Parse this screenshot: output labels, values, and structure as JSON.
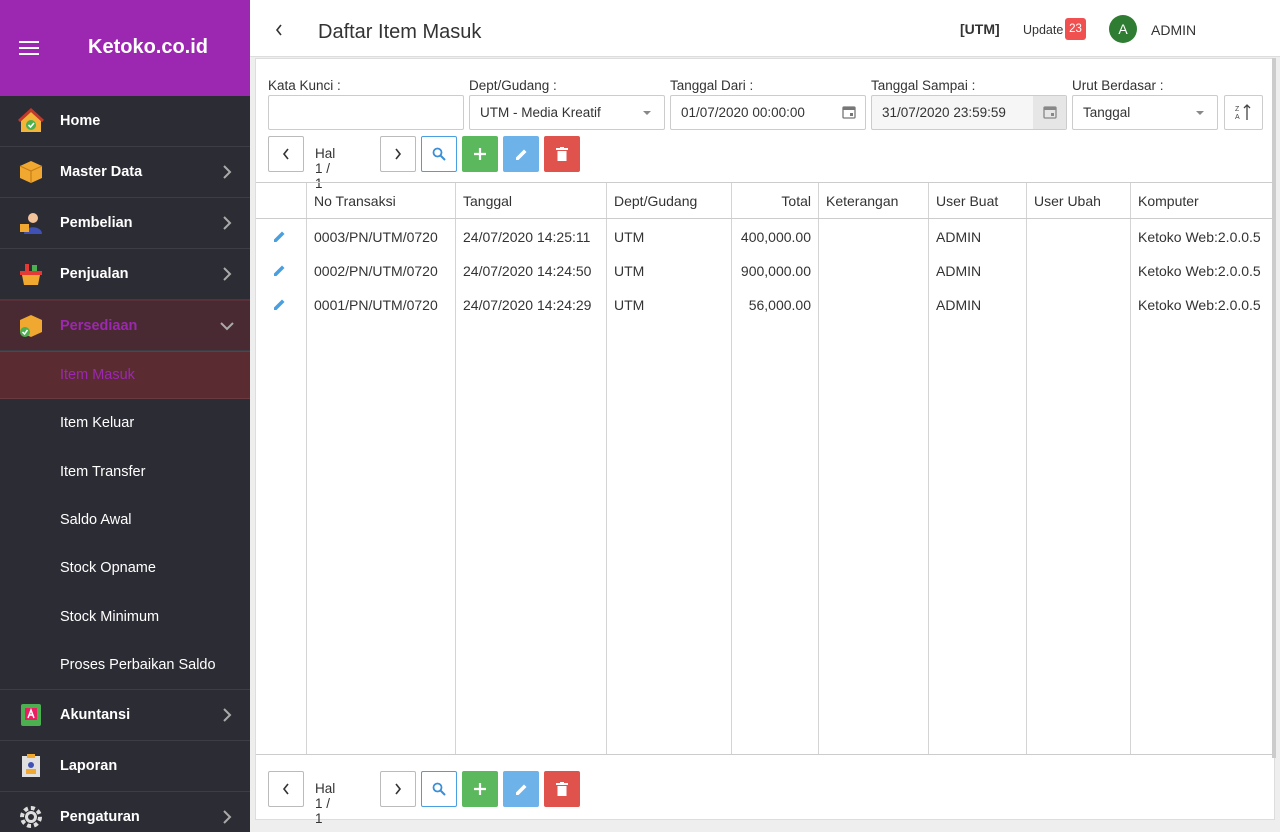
{
  "brand": {
    "name": "Ketoko.co.id",
    "color": "#9c27b0"
  },
  "sidebar": {
    "items": [
      {
        "label": "Home",
        "icon": "home-icon"
      },
      {
        "label": "Master Data",
        "icon": "box-icon"
      },
      {
        "label": "Pembelian",
        "icon": "buyer-icon"
      },
      {
        "label": "Penjualan",
        "icon": "basket-icon"
      },
      {
        "label": "Persediaan",
        "icon": "inventory-icon"
      },
      {
        "label": "Akuntansi",
        "icon": "ledger-icon"
      },
      {
        "label": "Laporan",
        "icon": "report-icon"
      },
      {
        "label": "Pengaturan",
        "icon": "gear-icon"
      }
    ],
    "sub_items": [
      "Item Masuk",
      "Item Keluar",
      "Item Transfer",
      "Saldo Awal",
      "Stock Opname",
      "Stock Minimum",
      "Proses Perbaikan Saldo"
    ]
  },
  "header": {
    "title": "Daftar Item Masuk",
    "branch": "[UTM]",
    "update_label": "Update",
    "update_count": "23",
    "avatar_letter": "A",
    "user": "ADMIN"
  },
  "filters": {
    "kata_kunci_label": "Kata Kunci :",
    "kata_kunci_value": "",
    "dept_label": "Dept/Gudang :",
    "dept_value": "UTM - Media Kreatif",
    "tanggal_dari_label": "Tanggal Dari :",
    "tanggal_dari_value": "01/07/2020 00:00:00",
    "tanggal_sampai_label": "Tanggal Sampai :",
    "tanggal_sampai_value": "31/07/2020 23:59:59",
    "urut_label": "Urut Berdasar :",
    "urut_value": "Tanggal"
  },
  "pagination": {
    "label": "Hal 1 / 1"
  },
  "table": {
    "columns": [
      "No Transaksi",
      "Tanggal",
      "Dept/Gudang",
      "Total",
      "Keterangan",
      "User Buat",
      "User Ubah",
      "Komputer"
    ],
    "rows": [
      [
        "0003/PN/UTM/0720",
        "24/07/2020 14:25:11",
        "UTM",
        "400,000.00",
        "",
        "ADMIN",
        "",
        "Ketoko Web:2.0.0.5"
      ],
      [
        "0002/PN/UTM/0720",
        "24/07/2020 14:24:50",
        "UTM",
        "900,000.00",
        "",
        "ADMIN",
        "",
        "Ketoko Web:2.0.0.5"
      ],
      [
        "0001/PN/UTM/0720",
        "24/07/2020 14:24:29",
        "UTM",
        "56,000.00",
        "",
        "ADMIN",
        "",
        "Ketoko Web:2.0.0.5"
      ]
    ]
  }
}
